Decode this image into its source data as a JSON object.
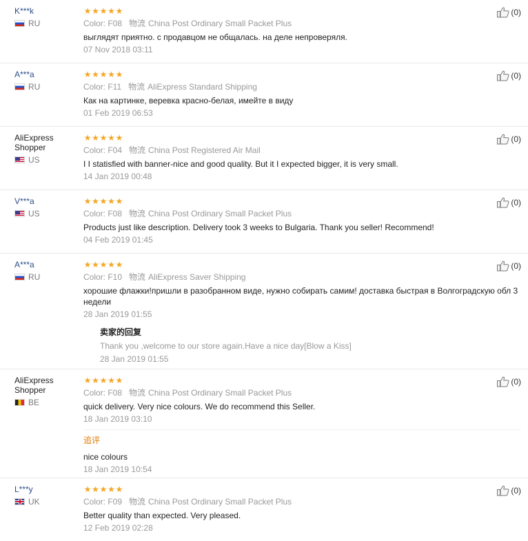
{
  "logistics_label": "物流",
  "reviews": [
    {
      "user": "K***k",
      "country": "RU",
      "rating": 5,
      "color": "Color: F08",
      "logistics": "China Post Ordinary Small Packet Plus",
      "text": "выглядят приятно. с продавцом не общалась. на деле непроверяля.",
      "date": "07 Nov 2018 03:11",
      "helpful": "(0)"
    },
    {
      "user": "A***a",
      "country": "RU",
      "rating": 5,
      "color": "Color: F11",
      "logistics": "AliExpress Standard Shipping",
      "text": "Как на картинке, веревка красно-белая, имейте в виду",
      "date": "01 Feb 2019 06:53",
      "helpful": "(0)"
    },
    {
      "user": "AliExpress Shopper",
      "country": "US",
      "rating": 5,
      "color": "Color: F04",
      "logistics": "China Post Registered Air Mail",
      "text": "I I statisfied with banner-nice and good quality. But it I expected bigger, it is very small.",
      "date": "14 Jan 2019 00:48",
      "helpful": "(0)"
    },
    {
      "user": "V***a",
      "country": "US",
      "rating": 5,
      "color": "Color: F08",
      "logistics": "China Post Ordinary Small Packet Plus",
      "text": "Products just like description. Delivery took 3 weeks to Bulgaria. Thank you seller! Recommend!",
      "date": "04 Feb 2019 01:45",
      "helpful": "(0)"
    },
    {
      "user": "A***a",
      "country": "RU",
      "rating": 5,
      "color": "Color: F10",
      "logistics": "AliExpress Saver Shipping",
      "text": "хорошие флажки!пришли в разобранном виде, нужно собирать самим! доставка быстрая в Волгоградскую обл 3 недели",
      "date": "28 Jan 2019 01:55",
      "helpful": "(0)",
      "seller_reply": {
        "title": "卖家的回复",
        "text": "Thank you ,welcome to our store again.Have a nice day[Blow a Kiss]",
        "date": "28 Jan 2019 01:55"
      }
    },
    {
      "user": "AliExpress Shopper",
      "country": "BE",
      "rating": 5,
      "color": "Color: F08",
      "logistics": "China Post Ordinary Small Packet Plus",
      "text": "quick delivery. Very nice colours. We do recommend this Seller.",
      "date": "18 Jan 2019 03:10",
      "helpful": "(0)",
      "followup": {
        "title": "追评",
        "text": "nice colours",
        "date": "18 Jan 2019 10:54"
      }
    },
    {
      "user": "L***y",
      "country": "UK",
      "rating": 5,
      "color": "Color: F09",
      "logistics": "China Post Ordinary Small Packet Plus",
      "text": "Better quality than expected. Very pleased.",
      "date": "12 Feb 2019 02:28",
      "helpful": "(0)"
    }
  ]
}
